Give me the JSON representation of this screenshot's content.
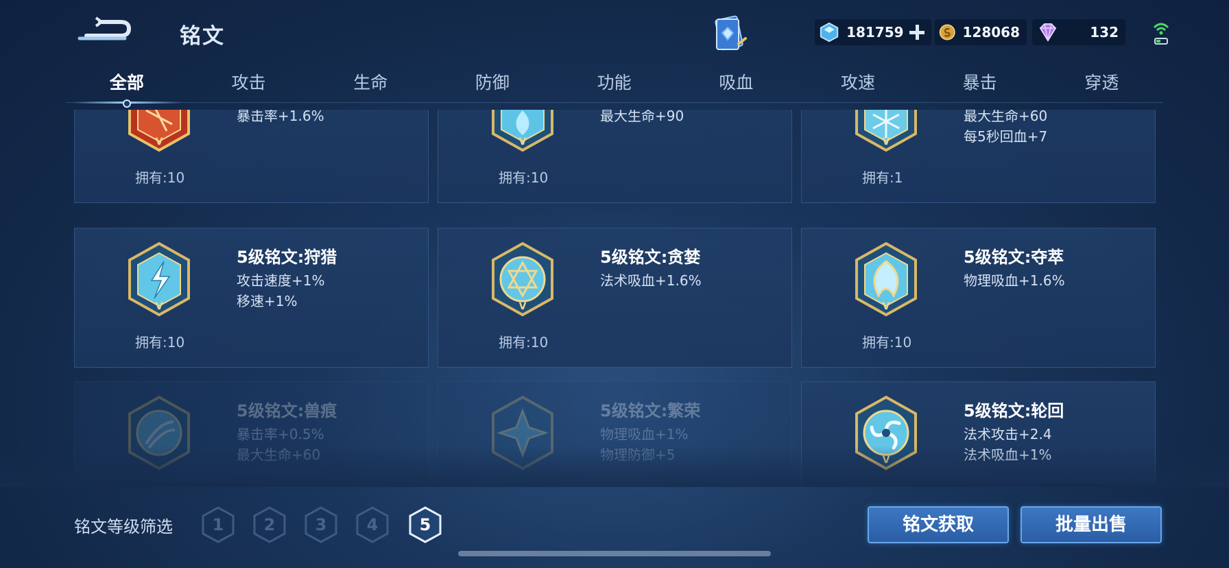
{
  "header": {
    "title": "铭文",
    "back_icon": "back-arrow-icon"
  },
  "currencies": {
    "coupon": {
      "icon": "coupon-crystal-icon",
      "value": "181759",
      "color": "#7fd0ff"
    },
    "gold": {
      "icon": "gold-coin-icon",
      "value": "128068",
      "color": "#e8b64c"
    },
    "gem": {
      "icon": "purple-gem-icon",
      "value": "132",
      "color": "#b989f0"
    }
  },
  "tabs": [
    {
      "label": "全部",
      "active": true
    },
    {
      "label": "攻击"
    },
    {
      "label": "生命"
    },
    {
      "label": "防御"
    },
    {
      "label": "功能"
    },
    {
      "label": "吸血"
    },
    {
      "label": "攻速"
    },
    {
      "label": "暴击"
    },
    {
      "label": "穿透"
    }
  ],
  "cards": [
    {
      "name": "",
      "attr1": "暴击率+1.6%",
      "attr2": "",
      "owned": "拥有:10",
      "emblem": "red-emblem-icon",
      "color": "#c8442a"
    },
    {
      "name": "",
      "attr1": "最大生命+90",
      "attr2": "",
      "owned": "拥有:10",
      "emblem": "blue-emblem-icon",
      "color": "#4fb4d8"
    },
    {
      "name": "",
      "attr1": "最大生命+60",
      "attr2": "每5秒回血+7",
      "owned": "拥有:1",
      "emblem": "blue-emblem-icon",
      "color": "#4fb4d8"
    },
    {
      "name": "5级铭文:狩猎",
      "attr1": "攻击速度+1%",
      "attr2": "移速+1%",
      "owned": "拥有:10",
      "emblem": "lightning-emblem-icon",
      "color": "#4fb4d8"
    },
    {
      "name": "5级铭文:贪婪",
      "attr1": "法术吸血+1.6%",
      "attr2": "",
      "owned": "拥有:10",
      "emblem": "star-emblem-icon",
      "color": "#4fb4d8"
    },
    {
      "name": "5级铭文:夺萃",
      "attr1": "物理吸血+1.6%",
      "attr2": "",
      "owned": "拥有:10",
      "emblem": "knot-emblem-icon",
      "color": "#4fb4d8"
    },
    {
      "name": "5级铭文:兽痕",
      "attr1": "暴击率+0.5%",
      "attr2": "最大生命+60",
      "owned": "",
      "emblem": "claw-emblem-icon",
      "color": "#4fb4d8",
      "dim": true
    },
    {
      "name": "5级铭文:繁荣",
      "attr1": "物理吸血+1%",
      "attr2": "物理防御+5",
      "owned": "",
      "emblem": "flower-emblem-icon",
      "color": "#4fb4d8",
      "dim": true
    },
    {
      "name": "5级铭文:轮回",
      "attr1": "法术攻击+2.4",
      "attr2": "法术吸血+1%",
      "owned": "",
      "emblem": "swirl-emblem-icon",
      "color": "#4fb4d8"
    }
  ],
  "filter": {
    "label": "铭文等级筛选",
    "levels": [
      "1",
      "2",
      "3",
      "4",
      "5"
    ],
    "active": "5"
  },
  "buttons": {
    "acquire": "铭文获取",
    "sell": "批量出售"
  }
}
